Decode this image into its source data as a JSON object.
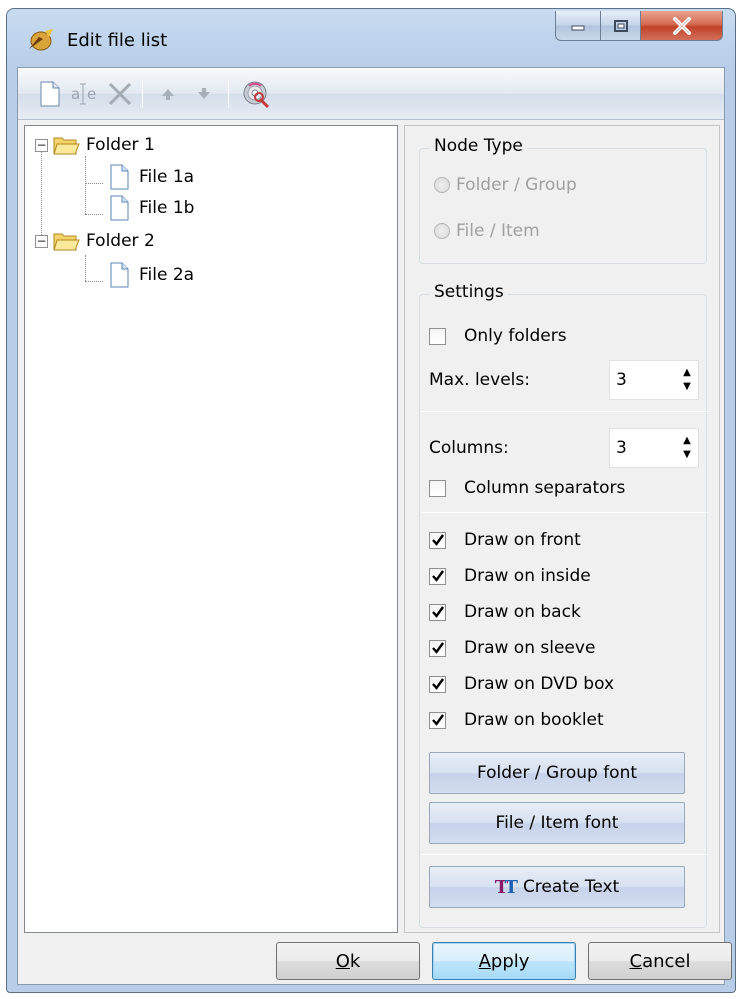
{
  "window": {
    "title": "Edit file list",
    "icons": {
      "app": "cd-burner-icon",
      "minimize": "minimize-icon",
      "maximize": "maximize-icon",
      "close": "close-icon"
    }
  },
  "toolbar": {
    "buttons": [
      {
        "name": "new-item",
        "icon": "new-document-icon"
      },
      {
        "name": "rename-item",
        "icon": "rename-icon"
      },
      {
        "name": "delete-item",
        "icon": "delete-icon"
      },
      {
        "name": "move-up",
        "icon": "arrow-up-icon"
      },
      {
        "name": "move-down",
        "icon": "arrow-down-icon"
      },
      {
        "name": "import-disc",
        "icon": "disc-scan-icon"
      }
    ]
  },
  "tree": {
    "nodes": [
      {
        "label": "Folder 1",
        "type": "folder",
        "level": 0,
        "expanded": true
      },
      {
        "label": "File 1a",
        "type": "file",
        "level": 1
      },
      {
        "label": "File 1b",
        "type": "file",
        "level": 1
      },
      {
        "label": "Folder 2",
        "type": "folder",
        "level": 0,
        "expanded": true
      },
      {
        "label": "File 2a",
        "type": "file",
        "level": 1
      }
    ]
  },
  "node_type": {
    "title": "Node Type",
    "options": [
      "Folder / Group",
      "File / Item"
    ]
  },
  "settings": {
    "title": "Settings",
    "only_folders": {
      "label": "Only folders",
      "checked": false
    },
    "max_levels": {
      "label": "Max. levels:",
      "value": "3"
    },
    "columns": {
      "label": "Columns:",
      "value": "3"
    },
    "column_separators": {
      "label": "Column separators",
      "checked": false
    },
    "draw_options": [
      {
        "label": "Draw on front",
        "checked": true
      },
      {
        "label": "Draw on inside",
        "checked": true
      },
      {
        "label": "Draw on back",
        "checked": true
      },
      {
        "label": "Draw on sleeve",
        "checked": true
      },
      {
        "label": "Draw on DVD box",
        "checked": true
      },
      {
        "label": "Draw on booklet",
        "checked": true
      }
    ],
    "folder_font_button": "Folder / Group font",
    "file_font_button": "File / Item font",
    "create_text_button": "Create Text"
  },
  "buttons": {
    "ok": {
      "label_underlined": "O",
      "label_rest": "k"
    },
    "apply": {
      "label_underlined": "A",
      "label_rest": "pply"
    },
    "cancel": {
      "label_underlined": "C",
      "label_rest": "ancel"
    }
  }
}
